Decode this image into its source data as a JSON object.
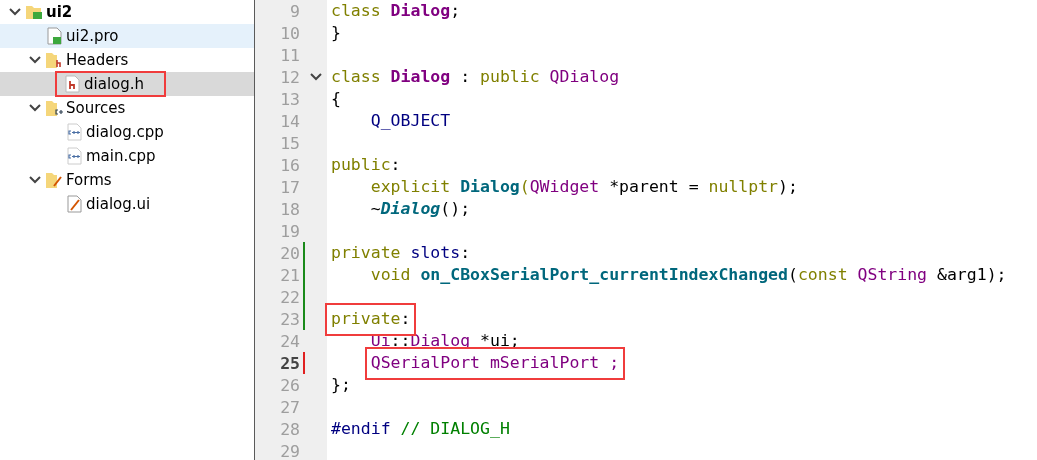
{
  "tree": {
    "label": "ui2",
    "kind": "project",
    "expanded": true,
    "selected": false,
    "hovered": false,
    "framed": false,
    "children": [
      {
        "label": "ui2.pro",
        "kind": "pro-file",
        "selected": false,
        "hovered": true,
        "framed": false
      },
      {
        "label": "Headers",
        "kind": "header-folder",
        "expanded": true,
        "selected": false,
        "hovered": false,
        "framed": false,
        "children": [
          {
            "label": "dialog.h",
            "kind": "header-file",
            "selected": true,
            "hovered": false,
            "framed": true
          }
        ]
      },
      {
        "label": "Sources",
        "kind": "source-folder",
        "expanded": true,
        "selected": false,
        "hovered": false,
        "framed": false,
        "children": [
          {
            "label": "dialog.cpp",
            "kind": "source-file",
            "selected": false,
            "hovered": false,
            "framed": false
          },
          {
            "label": "main.cpp",
            "kind": "source-file",
            "selected": false,
            "hovered": false,
            "framed": false
          }
        ]
      },
      {
        "label": "Forms",
        "kind": "form-folder",
        "expanded": true,
        "selected": false,
        "hovered": false,
        "framed": false,
        "children": [
          {
            "label": "dialog.ui",
            "kind": "form-file",
            "selected": false,
            "hovered": false,
            "framed": false
          }
        ]
      }
    ]
  },
  "editor": {
    "lines": [
      {
        "number": "9",
        "current": false,
        "added": false,
        "modified": false,
        "foldable": false,
        "indented": false,
        "tokens": [
          {
            "kind": "keyword",
            "text": "class "
          },
          {
            "kind": "class",
            "text": "Dialog"
          },
          {
            "kind": "plain",
            "text": ";"
          }
        ]
      },
      {
        "number": "10",
        "current": false,
        "added": false,
        "modified": false,
        "foldable": false,
        "indented": false,
        "tokens": [
          {
            "kind": "plain",
            "text": "}"
          }
        ]
      },
      {
        "number": "11",
        "current": false,
        "added": false,
        "modified": false,
        "foldable": false
      },
      {
        "number": "12",
        "current": false,
        "added": false,
        "modified": false,
        "foldable": true,
        "indented": false,
        "tokens": [
          {
            "kind": "keyword",
            "text": "class "
          },
          {
            "kind": "class",
            "text": "Dialog"
          },
          {
            "kind": "plain",
            "text": " : "
          },
          {
            "kind": "keyword",
            "text": "public "
          },
          {
            "kind": "type",
            "text": "QDialog"
          }
        ]
      },
      {
        "number": "13",
        "current": false,
        "added": false,
        "modified": false,
        "foldable": false,
        "indented": false,
        "tokens": [
          {
            "kind": "plain",
            "text": "{"
          }
        ]
      },
      {
        "number": "14",
        "current": false,
        "added": false,
        "modified": false,
        "foldable": false,
        "indented": true,
        "tokens": [
          {
            "kind": "macro",
            "text": "Q_OBJECT"
          }
        ]
      },
      {
        "number": "15",
        "current": false,
        "added": false,
        "modified": false,
        "foldable": false
      },
      {
        "number": "16",
        "current": false,
        "added": false,
        "modified": false,
        "foldable": false,
        "indented": false,
        "tokens": [
          {
            "kind": "keyword",
            "text": "public"
          },
          {
            "kind": "plain",
            "text": ":"
          }
        ]
      },
      {
        "number": "17",
        "current": false,
        "added": false,
        "modified": false,
        "foldable": false,
        "indented": true,
        "tokens": [
          {
            "kind": "keyword",
            "text": "explicit "
          },
          {
            "kind": "function",
            "text": "Dialog"
          },
          {
            "kind": "keyword",
            "text": "("
          },
          {
            "kind": "type",
            "text": "QWidget"
          },
          {
            "kind": "plain",
            "text": " *parent = "
          },
          {
            "kind": "keyword",
            "text": "nullptr"
          },
          {
            "kind": "plain",
            "text": ");"
          }
        ]
      },
      {
        "number": "18",
        "current": false,
        "added": false,
        "modified": false,
        "foldable": false,
        "indented": true,
        "tokens": [
          {
            "kind": "plain",
            "text": "~"
          },
          {
            "kind": "virtual-function",
            "text": "Dialog"
          },
          {
            "kind": "plain",
            "text": "();"
          }
        ]
      },
      {
        "number": "19",
        "current": false,
        "added": false,
        "modified": false,
        "foldable": false
      },
      {
        "number": "20",
        "current": false,
        "added": true,
        "modified": false,
        "foldable": false,
        "indented": false,
        "tokens": [
          {
            "kind": "keyword",
            "text": "private "
          },
          {
            "kind": "macro",
            "text": "slots"
          },
          {
            "kind": "plain",
            "text": ":"
          }
        ]
      },
      {
        "number": "21",
        "current": false,
        "added": true,
        "modified": false,
        "foldable": false,
        "indented": true,
        "tokens": [
          {
            "kind": "keyword",
            "text": "void "
          },
          {
            "kind": "function",
            "text": "on_CBoxSerialPort_currentIndexChanged"
          },
          {
            "kind": "plain",
            "text": "("
          },
          {
            "kind": "keyword",
            "text": "const "
          },
          {
            "kind": "type",
            "text": "QString"
          },
          {
            "kind": "plain",
            "text": " &arg1);"
          }
        ]
      },
      {
        "number": "22",
        "current": false,
        "added": true,
        "modified": false,
        "foldable": false
      },
      {
        "number": "23",
        "current": false,
        "added": true,
        "modified": false,
        "foldable": false,
        "indented": false,
        "tokens": [
          {
            "kind": "frame",
            "tokens": [
              {
                "kind": "keyword",
                "text": "private"
              },
              {
                "kind": "plain",
                "text": ":"
              }
            ]
          }
        ]
      },
      {
        "number": "24",
        "current": false,
        "added": false,
        "modified": false,
        "foldable": false,
        "indented": true,
        "tokens": [
          {
            "kind": "type",
            "text": "Ui"
          },
          {
            "kind": "plain",
            "text": "::"
          },
          {
            "kind": "type",
            "text": "Dialog"
          },
          {
            "kind": "plain",
            "text": " *ui;"
          }
        ]
      },
      {
        "number": "25",
        "current": true,
        "added": false,
        "modified": true,
        "foldable": false,
        "indented": true,
        "tokens": [
          {
            "kind": "frame",
            "tokens": [
              {
                "kind": "type",
                "text": "QSerialPort mSerialPort ;"
              }
            ]
          }
        ]
      },
      {
        "number": "26",
        "current": false,
        "added": false,
        "modified": false,
        "foldable": false,
        "indented": false,
        "tokens": [
          {
            "kind": "plain",
            "text": "};"
          }
        ]
      },
      {
        "number": "27",
        "current": false,
        "added": false,
        "modified": false,
        "foldable": false
      },
      {
        "number": "28",
        "current": false,
        "added": false,
        "modified": false,
        "foldable": false,
        "indented": false,
        "tokens": [
          {
            "kind": "preprocessor",
            "text": "#endif "
          },
          {
            "kind": "comment",
            "text": "// DIALOG_H"
          }
        ]
      },
      {
        "number": "29",
        "current": false,
        "added": false,
        "modified": false,
        "foldable": false
      }
    ]
  }
}
